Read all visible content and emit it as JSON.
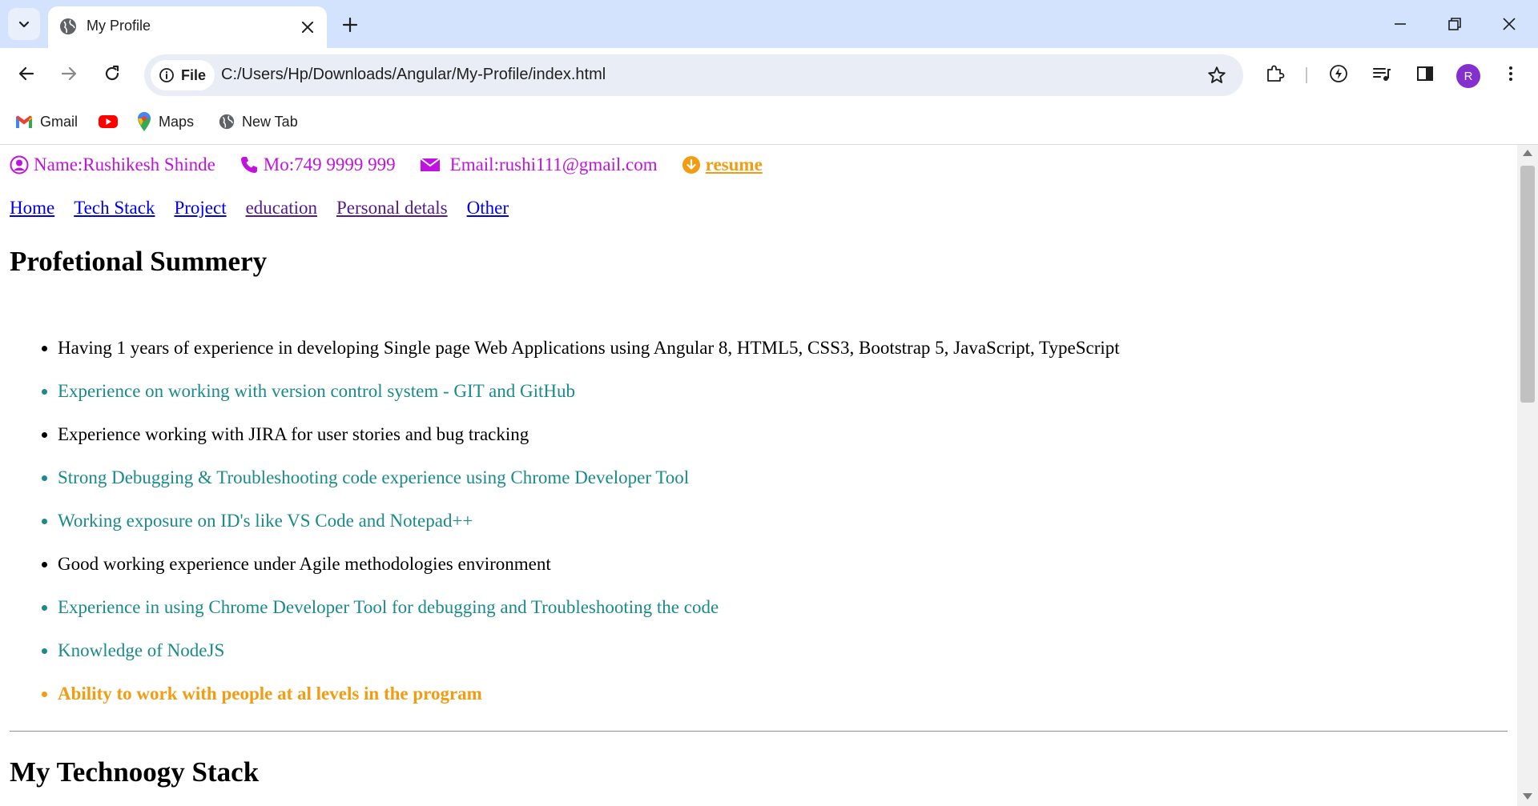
{
  "browser": {
    "tab_title": "My Profile",
    "site_chip_label": "File",
    "url": "C:/Users/Hp/Downloads/Angular/My-Profile/index.html",
    "avatar_letter": "R",
    "bookmarks": [
      {
        "label": "Gmail",
        "icon": "gmail-icon"
      },
      {
        "label": "",
        "icon": "youtube-icon"
      },
      {
        "label": "Maps",
        "icon": "maps-icon"
      },
      {
        "label": "New Tab",
        "icon": "globe-icon"
      }
    ]
  },
  "header": {
    "name": "Name:Rushikesh Shinde",
    "mobile": "Mo:749 9999 999",
    "email": "Email:rushi111@gmail.com",
    "resume": " resume"
  },
  "nav": {
    "links": [
      "Home",
      "Tech Stack",
      "Project",
      "education",
      "Personal detals",
      "Other"
    ]
  },
  "summary": {
    "heading": "Profetional Summery",
    "items": [
      "Having 1 years of experience in developing Single page Web Applications using Angular 8, HTML5, CSS3, Bootstrap 5, JavaScript, TypeScript",
      "Experience on working with version control system - GIT and GitHub",
      "Experience working with JIRA for user stories and bug tracking",
      "Strong Debugging & Troubleshooting code experience using Chrome Developer Tool",
      "Working exposure on ID's like VS Code and Notepad++",
      "Good working experience under Agile methodologies environment",
      "Experience in using Chrome Developer Tool for debugging and Troubleshooting the code",
      "Knowledge of NodeJS",
      "Ability to work with people at al levels in the program"
    ]
  },
  "tech": {
    "heading": "My Technoogy Stack"
  },
  "colors": {
    "contact": "#c112e0",
    "resume": "#f39c12",
    "teal_item": "#1b8a8a",
    "link": "#0000ee",
    "visited_link": "#551a8b"
  }
}
